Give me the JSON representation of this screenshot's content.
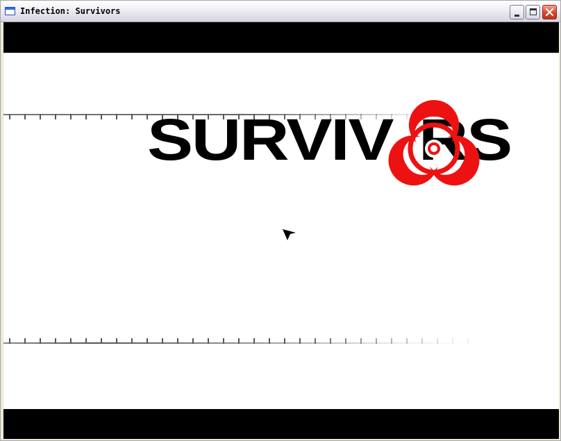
{
  "window": {
    "title": "Infection: Survivors",
    "icons": [
      "app-window-icon",
      "minimize-icon",
      "maximize-icon",
      "close-icon"
    ]
  },
  "game": {
    "logo_text": "SURVIVORS",
    "logo_text_before_symbol": "SURVIV",
    "logo_text_after_symbol": "RS",
    "symbol": "biohazard-icon",
    "colors": {
      "letterbox": "#000000",
      "background": "#ffffff",
      "logo_text": "#000000",
      "biohazard": "#ee1111"
    }
  }
}
